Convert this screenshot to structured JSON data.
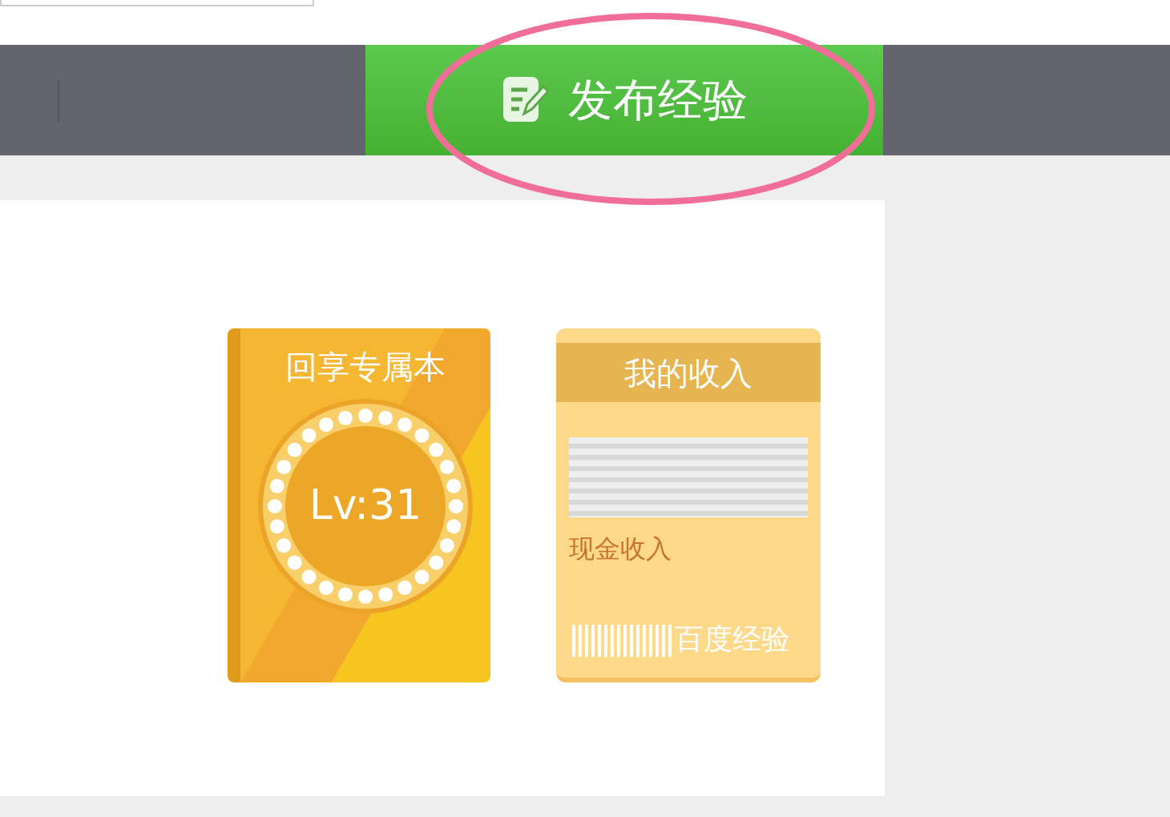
{
  "nav_bar": {
    "publish_button": {
      "label": "发布经验"
    }
  },
  "level_card": {
    "title": "回享专属本",
    "level": "Lv:31"
  },
  "income_card": {
    "title": "我的收入",
    "caption": "现金收入",
    "footer": "百度经验"
  }
}
